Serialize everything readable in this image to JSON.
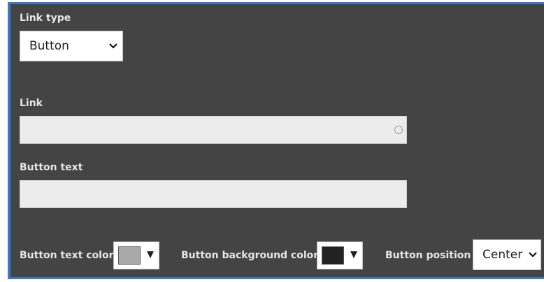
{
  "link_type": {
    "label": "Link type",
    "selected": "Button"
  },
  "link": {
    "label": "Link",
    "value": ""
  },
  "button_text": {
    "label": "Button text",
    "value": ""
  },
  "button_text_color": {
    "label": "Button text color",
    "color": "#a9a9a9"
  },
  "button_background_color": {
    "label": "Button background color",
    "color": "#222222"
  },
  "button_position": {
    "label": "Button position",
    "selected": "Center"
  },
  "colors": {
    "panel_bg": "#444444",
    "panel_border": "#3f78c6",
    "input_bg": "#ececec"
  }
}
